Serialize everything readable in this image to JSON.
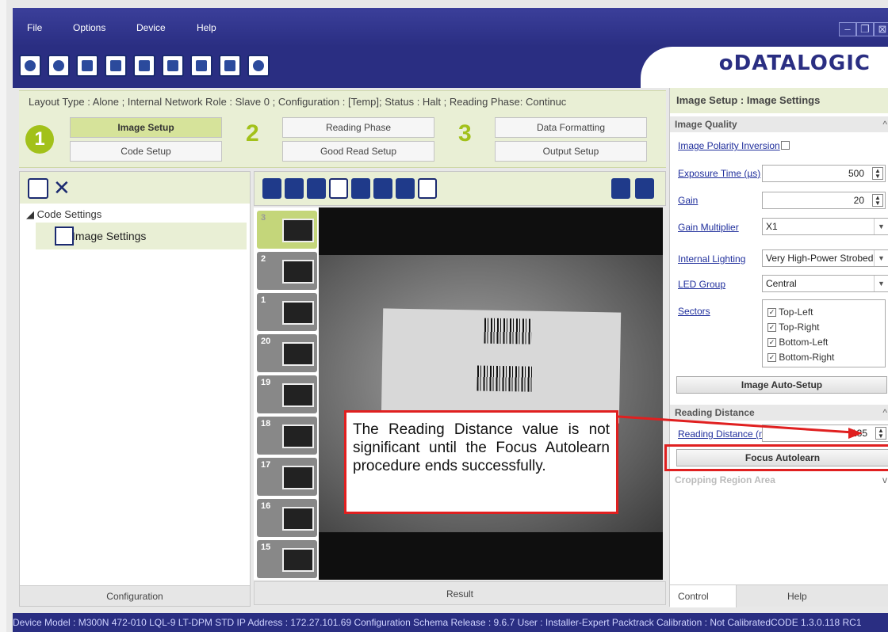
{
  "menubar": {
    "items": [
      "File",
      "Options",
      "Device",
      "Help"
    ],
    "window_controls": [
      "minimize-icon",
      "restore-icon",
      "close-icon"
    ]
  },
  "brand": "ᴏDATALOGIC",
  "status_line": "Layout Type : Alone ; Internal Network Role : Slave 0 ; Configuration : [Temp]; Status : Halt ; Reading Phase: Continuc",
  "steps": {
    "n1": "1",
    "n2": "2",
    "n3": "3",
    "image_setup": "Image Setup",
    "code_setup": "Code Setup",
    "reading_phase": "Reading Phase",
    "good_read_setup": "Good Read Setup",
    "data_formatting": "Data Formatting",
    "output_setup": "Output Setup"
  },
  "tree": {
    "root": "◢ Code Settings",
    "child": "Image Settings"
  },
  "left_footer": "Configuration",
  "thumbnails": [
    "3",
    "2",
    "1",
    "20",
    "19",
    "18",
    "17",
    "16",
    "15"
  ],
  "mid_footer": "Result",
  "callout": "The Reading Distance value is not significant until the Focus Autolearn procedure ends successfully.",
  "right": {
    "title": "Image Setup : Image Settings",
    "section_quality": "Image Quality",
    "image_polarity_label": "Image Polarity Inversion",
    "exposure_label": "Exposure Time (µs)",
    "exposure_value": "500",
    "gain_label": "Gain",
    "gain_value": "20",
    "gain_mult_label": "Gain Multiplier",
    "gain_mult_value": "X1",
    "lighting_label": "Internal Lighting",
    "lighting_value": "Very High-Power Strobed",
    "led_label": "LED Group",
    "led_value": "Central",
    "sectors_label": "Sectors",
    "sectors": [
      "Top-Left",
      "Top-Right",
      "Bottom-Left",
      "Bottom-Right"
    ],
    "auto_setup_btn": "Image Auto-Setup",
    "section_reading": "Reading Distance",
    "reading_label": "Reading Distance (mm)",
    "reading_value": "135",
    "focus_btn": "Focus Autolearn",
    "section_cropping": "Cropping Region Area",
    "tab_control": "Control",
    "tab_help": "Help"
  },
  "statusbar": "Device Model : M300N 472-010 LQL-9 LT-DPM STD   IP Address : 172.27.101.69   Configuration Schema Release : 9.6.7   User : Installer-Expert   Packtrack Calibration : Not CalibratedCODE 1.3.0.118 RC1"
}
